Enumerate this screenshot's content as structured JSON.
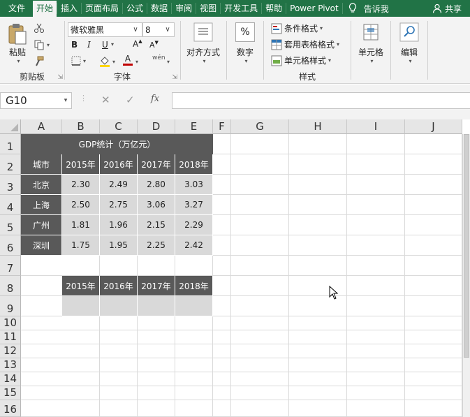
{
  "tabs": [
    {
      "label": "文件"
    },
    {
      "label": "开始",
      "active": true
    },
    {
      "label": "插入"
    },
    {
      "label": "页面布局"
    },
    {
      "label": "公式"
    },
    {
      "label": "数据"
    },
    {
      "label": "审阅"
    },
    {
      "label": "视图"
    },
    {
      "label": "开发工具"
    },
    {
      "label": "帮助"
    },
    {
      "label": "Power Pivot"
    }
  ],
  "tell_me": "告诉我",
  "share": "共享",
  "ribbon": {
    "clipboard": {
      "paste_label": "粘贴",
      "group_label": "剪贴板"
    },
    "font": {
      "font_name": "微软雅黑",
      "font_size": "8",
      "bold": "B",
      "italic": "I",
      "underline": "U",
      "grow": "A",
      "shrink": "A",
      "wen": "wén",
      "font_color_letter": "A",
      "group_label": "字体"
    },
    "alignment": {
      "label": "对齐方式"
    },
    "number": {
      "label": "数字",
      "icon_text": "%"
    },
    "styles": {
      "conditional": "条件格式",
      "table": "套用表格格式",
      "cell_styles": "单元格样式",
      "group_label": "样式"
    },
    "cells": {
      "label": "单元格"
    },
    "editing": {
      "label": "编辑"
    }
  },
  "formula_bar": {
    "name_box": "G10",
    "fx": "fx",
    "formula": ""
  },
  "columns": [
    "A",
    "B",
    "C",
    "D",
    "E",
    "F",
    "G",
    "H",
    "I",
    "J"
  ],
  "rows": [
    "1",
    "2",
    "3",
    "4",
    "5",
    "6",
    "7",
    "8",
    "9",
    "10",
    "11",
    "12",
    "13",
    "14",
    "15",
    "16"
  ],
  "sheet": {
    "title": "GDP统计（万亿元）",
    "header_row": [
      "城市",
      "2015年",
      "2016年",
      "2017年",
      "2018年"
    ],
    "data_rows": [
      [
        "北京",
        "2.30",
        "2.49",
        "2.80",
        "3.03"
      ],
      [
        "上海",
        "2.50",
        "2.75",
        "3.06",
        "3.27"
      ],
      [
        "广州",
        "1.81",
        "1.96",
        "2.15",
        "2.29"
      ],
      [
        "深圳",
        "1.75",
        "1.95",
        "2.25",
        "2.42"
      ]
    ],
    "second_header": [
      "2015年",
      "2016年",
      "2017年",
      "2018年"
    ]
  },
  "colors": {
    "accent": "#217346",
    "dark_cell": "#595959",
    "light_cell": "#d9d9d9"
  }
}
